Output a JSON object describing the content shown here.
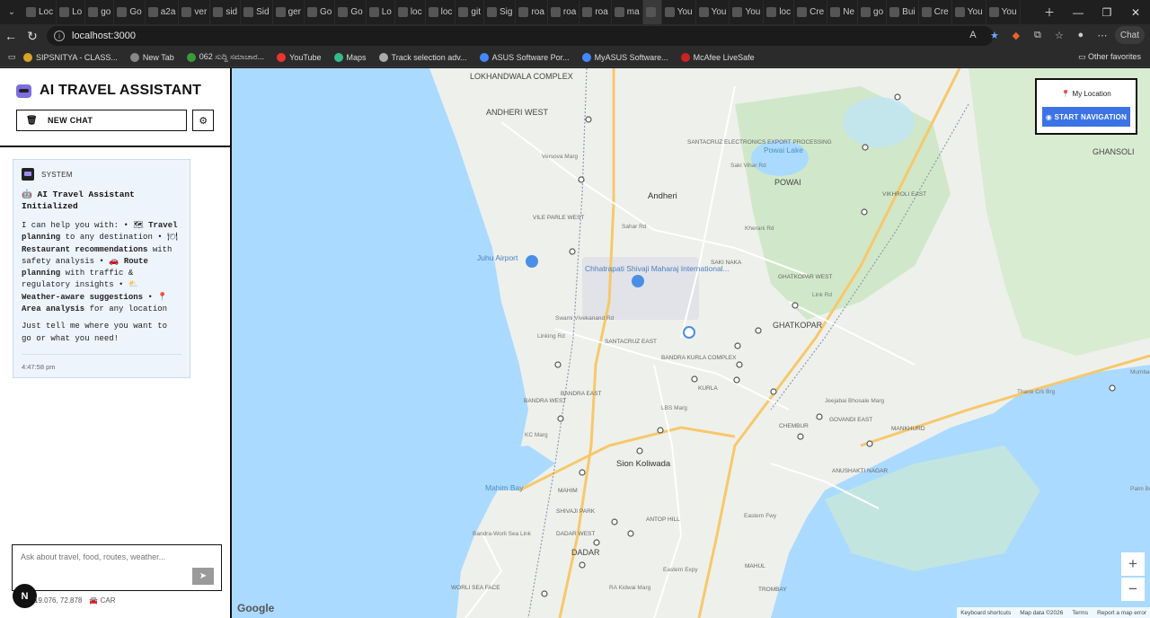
{
  "browser": {
    "tabs": [
      "Loc",
      "Lo",
      "go",
      "Go",
      "a2a",
      "ver",
      "sid",
      "Sid",
      "ger",
      "Go",
      "Go",
      "Lo",
      "loc",
      "loc",
      "git",
      "Sig",
      "roa",
      "roa",
      "roa",
      "ma",
      "",
      "You",
      "You",
      "You",
      "loc",
      "Cre",
      "Ne",
      "go",
      "Bui",
      "Cre",
      "You",
      "You"
    ],
    "active_tab_index": 20,
    "url": "localhost:3000",
    "copilot_label": "Chat",
    "bookmarks": [
      "SIPSNITYA - CLASS...",
      "New Tab",
      "062 ಸುದ್ದಿ ಸಮಾಚಾರ...",
      "YouTube",
      "Maps",
      "Track selection adv...",
      "ASUS Software Por...",
      "MyASUS Software...",
      "McAfee LiveSafe"
    ],
    "other_favorites": "Other favorites"
  },
  "sidebar": {
    "title": "AI TRAVEL ASSISTANT",
    "new_chat_label": "NEW CHAT",
    "message": {
      "role": "SYSTEM",
      "title": "AI Travel Assistant Initialized",
      "intro": "I can help you with:",
      "items": [
        {
          "bold": "Travel planning",
          "rest": "to any destination"
        },
        {
          "bold": "Restaurant recommendations",
          "rest": "with safety analysis"
        },
        {
          "bold": "Route planning",
          "rest": "with traffic & regulatory insights"
        },
        {
          "bold": "Weather-aware suggestions",
          "rest": ""
        },
        {
          "bold": "Area analysis",
          "rest": "for any location"
        }
      ],
      "closing": "Just tell me where you want to go or what you need!",
      "time": "4:47:58 pm"
    },
    "composer_placeholder": "Ask about travel, food, routes, weather...",
    "coords": "19.076, 72.878",
    "mode": "CAR",
    "nav_badge": "N"
  },
  "map": {
    "my_location_label": "My Location",
    "start_nav_label": "START NAVIGATION",
    "zoom_in": "+",
    "zoom_out": "−",
    "google_logo": "Google",
    "attribution": [
      "Keyboard shortcuts",
      "Map data ©2026",
      "Terms",
      "Report a map error"
    ],
    "labels": [
      {
        "text": "LOKHANDWALA COMPLEX",
        "style": "area"
      },
      {
        "text": "ANDHERI WEST",
        "style": "area"
      },
      {
        "text": "Andheri",
        "style": "city"
      },
      {
        "text": "POWAI",
        "style": "area"
      },
      {
        "text": "Powai Lake",
        "style": "water"
      },
      {
        "text": "GHANSOLI",
        "style": "area"
      },
      {
        "text": "VILE PARLE WEST",
        "style": "small"
      },
      {
        "text": "Juhu Airport",
        "style": "poi"
      },
      {
        "text": "Chhatrapati Shivaji Maharaj International...",
        "style": "poi"
      },
      {
        "text": "SAKI NAKA",
        "style": "small"
      },
      {
        "text": "VIKHROLI EAST",
        "style": "small"
      },
      {
        "text": "GHATKOPAR WEST",
        "style": "small"
      },
      {
        "text": "GHATKOPAR",
        "style": "area"
      },
      {
        "text": "SANTACRUZ EAST",
        "style": "small"
      },
      {
        "text": "BANDRA KURLA COMPLEX",
        "style": "small"
      },
      {
        "text": "BANDRA EAST",
        "style": "small"
      },
      {
        "text": "BANDRA WEST",
        "style": "small"
      },
      {
        "text": "KURLA",
        "style": "small"
      },
      {
        "text": "CHEMBUR",
        "style": "small"
      },
      {
        "text": "GOVANDI EAST",
        "style": "small"
      },
      {
        "text": "MANKHURD",
        "style": "small"
      },
      {
        "text": "Sion Koliwada",
        "style": "city"
      },
      {
        "text": "MAHIM",
        "style": "small"
      },
      {
        "text": "SHIVAJI PARK",
        "style": "small"
      },
      {
        "text": "ANTOP HILL",
        "style": "small"
      },
      {
        "text": "DADAR WEST",
        "style": "small"
      },
      {
        "text": "DADAR",
        "style": "area"
      },
      {
        "text": "WORLI SEA FACE",
        "style": "small"
      },
      {
        "text": "MAHUL",
        "style": "small"
      },
      {
        "text": "TROMBAY",
        "style": "small"
      },
      {
        "text": "ANUSHAKTI NAGAR",
        "style": "small"
      },
      {
        "text": "SANTACRUZ ELECTRONICS EXPORT PROCESSING",
        "style": "small"
      },
      {
        "text": "Mahim Bay",
        "style": "water"
      },
      {
        "text": "Thane Crk Brg",
        "style": "road"
      },
      {
        "text": "Palm Beach Rd",
        "style": "road"
      },
      {
        "text": "Mumbai",
        "style": "road"
      },
      {
        "text": "Jeejabai Bhosale Marg",
        "style": "road"
      },
      {
        "text": "LBS Marg",
        "style": "road"
      },
      {
        "text": "Link Rd",
        "style": "road"
      },
      {
        "text": "Versova Marg",
        "style": "road"
      },
      {
        "text": "Sahar Rd",
        "style": "road"
      },
      {
        "text": "Kherani Rd",
        "style": "road"
      },
      {
        "text": "Saki Vihar Rd",
        "style": "road"
      },
      {
        "text": "Linking Rd",
        "style": "road"
      },
      {
        "text": "KC Marg",
        "style": "road"
      },
      {
        "text": "Eastern Fwy",
        "style": "road"
      },
      {
        "text": "Bandra-Worli Sea Link",
        "style": "road"
      },
      {
        "text": "Swami Vivekanand Rd",
        "style": "road"
      },
      {
        "text": "RA Kidwai Marg",
        "style": "road"
      },
      {
        "text": "Eastern Expy",
        "style": "road"
      }
    ]
  }
}
